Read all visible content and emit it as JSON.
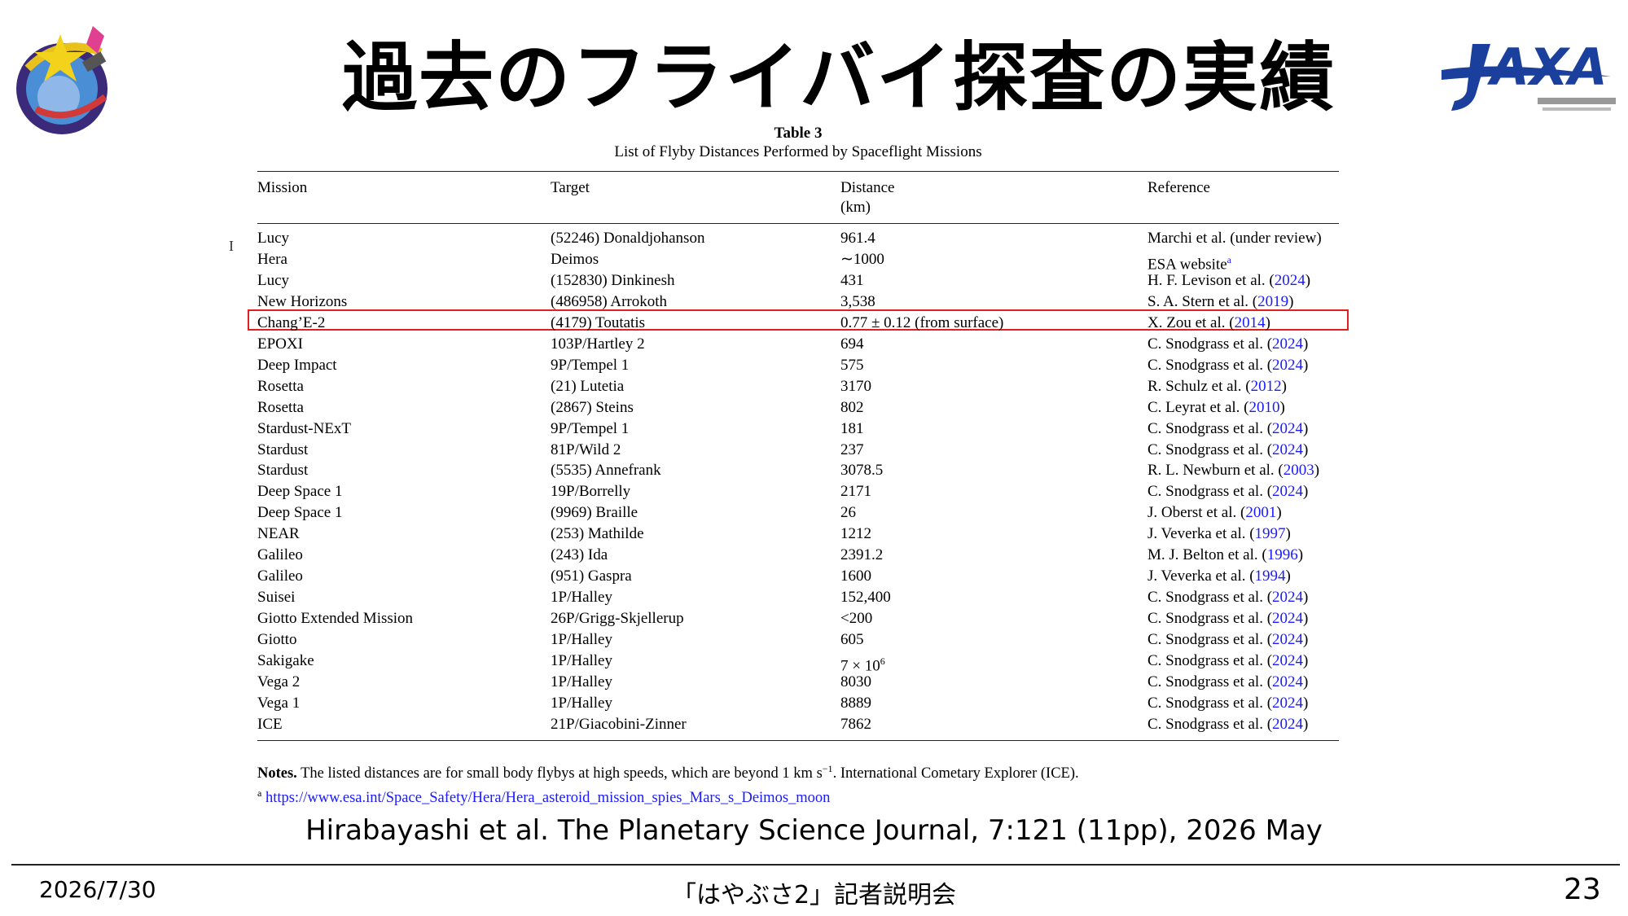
{
  "slide": {
    "title": "過去のフライバイ探査の実績",
    "citation": "Hirabayashi et al. The Planetary Science Journal, 7:121 (11pp), 2026 May",
    "footer_date": "2026/7/30",
    "footer_event": "「はやぶさ2」記者説明会",
    "page_number": "23",
    "highlight_color": "#e02020",
    "link_color": "#1a1aff"
  },
  "logos": {
    "mission_logo_text": "HAYABUSA 2",
    "jaxa_logo_text": "JAXA"
  },
  "table": {
    "number": "Table 3",
    "caption": "List of Flyby Distances Performed by Spaceflight Missions",
    "headers": {
      "mission": "Mission",
      "target": "Target",
      "distance": "Distance",
      "distance_unit": "(km)",
      "reference": "Reference"
    },
    "rows": [
      {
        "mission": "Lucy",
        "target": "(52246) Donaldjohanson",
        "distance": "961.4",
        "ref_text": "Marchi et al. (under review)",
        "ref_year": ""
      },
      {
        "mission": "Hera",
        "target": "Deimos",
        "distance": "∼1000",
        "ref_text": "ESA website",
        "ref_year": "",
        "ref_sup": "a"
      },
      {
        "mission": "Lucy",
        "target": "(152830) Dinkinesh",
        "distance": "431",
        "ref_text": "H. F. Levison et al. (",
        "ref_year": "2024",
        "ref_close": ")"
      },
      {
        "mission": "New Horizons",
        "target": "(486958) Arrokoth",
        "distance": "3,538",
        "ref_text": "S. A. Stern et al. (",
        "ref_year": "2019",
        "ref_close": ")"
      },
      {
        "mission": "Chang’E-2",
        "target": "(4179) Toutatis",
        "distance": "0.77 ± 0.12 (from surface)",
        "ref_text": "X. Zou et al. (",
        "ref_year": "2014",
        "ref_close": ")",
        "highlighted": true
      },
      {
        "mission": "EPOXI",
        "target": "103P/Hartley 2",
        "distance": "694",
        "ref_text": "C. Snodgrass et al. (",
        "ref_year": "2024",
        "ref_close": ")"
      },
      {
        "mission": "Deep Impact",
        "target": "9P/Tempel 1",
        "distance": "575",
        "ref_text": "C. Snodgrass et al. (",
        "ref_year": "2024",
        "ref_close": ")"
      },
      {
        "mission": "Rosetta",
        "target": "(21) Lutetia",
        "distance": "3170",
        "ref_text": "R. Schulz et al. (",
        "ref_year": "2012",
        "ref_close": ")"
      },
      {
        "mission": "Rosetta",
        "target": "(2867) Steins",
        "distance": "802",
        "ref_text": "C. Leyrat et al. (",
        "ref_year": "2010",
        "ref_close": ")"
      },
      {
        "mission": "Stardust-NExT",
        "target": "9P/Tempel 1",
        "distance": "181",
        "ref_text": "C. Snodgrass et al. (",
        "ref_year": "2024",
        "ref_close": ")"
      },
      {
        "mission": "Stardust",
        "target": "81P/Wild 2",
        "distance": "237",
        "ref_text": "C. Snodgrass et al. (",
        "ref_year": "2024",
        "ref_close": ")"
      },
      {
        "mission": "Stardust",
        "target": "(5535) Annefrank",
        "distance": "3078.5",
        "ref_text": "R. L. Newburn et al. (",
        "ref_year": "2003",
        "ref_close": ")"
      },
      {
        "mission": "Deep Space 1",
        "target": "19P/Borrelly",
        "distance": "2171",
        "ref_text": "C. Snodgrass et al. (",
        "ref_year": "2024",
        "ref_close": ")"
      },
      {
        "mission": "Deep Space 1",
        "target": "(9969) Braille",
        "distance": "26",
        "ref_text": "J. Oberst et al. (",
        "ref_year": "2001",
        "ref_close": ")"
      },
      {
        "mission": "NEAR",
        "target": "(253) Mathilde",
        "distance": "1212",
        "ref_text": "J. Veverka et al. (",
        "ref_year": "1997",
        "ref_close": ")"
      },
      {
        "mission": "Galileo",
        "target": "(243) Ida",
        "distance": "2391.2",
        "ref_text": "M. J. Belton et al. (",
        "ref_year": "1996",
        "ref_close": ")"
      },
      {
        "mission": "Galileo",
        "target": "(951) Gaspra",
        "distance": "1600",
        "ref_text": "J. Veverka et al. (",
        "ref_year": "1994",
        "ref_close": ")"
      },
      {
        "mission": "Suisei",
        "target": "1P/Halley",
        "distance": "152,400",
        "ref_text": "C. Snodgrass et al. (",
        "ref_year": "2024",
        "ref_close": ")"
      },
      {
        "mission": "Giotto Extended Mission",
        "target": "26P/Grigg-Skjellerup",
        "distance": "<200",
        "ref_text": "C. Snodgrass et al. (",
        "ref_year": "2024",
        "ref_close": ")"
      },
      {
        "mission": "Giotto",
        "target": "1P/Halley",
        "distance": "605",
        "ref_text": "C. Snodgrass et al. (",
        "ref_year": "2024",
        "ref_close": ")"
      },
      {
        "mission": "Sakigake",
        "target": "1P/Halley",
        "distance": "7 × 10",
        "distance_sup": "6",
        "ref_text": "C. Snodgrass et al. (",
        "ref_year": "2024",
        "ref_close": ")"
      },
      {
        "mission": "Vega 2",
        "target": "1P/Halley",
        "distance": "8030",
        "ref_text": "C. Snodgrass et al. (",
        "ref_year": "2024",
        "ref_close": ")"
      },
      {
        "mission": "Vega 1",
        "target": "1P/Halley",
        "distance": "8889",
        "ref_text": "C. Snodgrass et al. (",
        "ref_year": "2024",
        "ref_close": ")"
      },
      {
        "mission": "ICE",
        "target": "21P/Giacobini-Zinner",
        "distance": "7862",
        "ref_text": "C. Snodgrass et al. (",
        "ref_year": "2024",
        "ref_close": ")"
      }
    ],
    "notes": {
      "label": "Notes.",
      "text_before": " The listed distances are for small body flybys at high speeds, which are beyond 1 km s",
      "text_sup": "−1",
      "text_after": ". International Cometary Explorer (ICE).",
      "footnote_marker": "a",
      "footnote_url": "https://www.esa.int/Space_Safety/Hera/Hera_asteroid_mission_spies_Mars_s_Deimos_moon"
    }
  }
}
